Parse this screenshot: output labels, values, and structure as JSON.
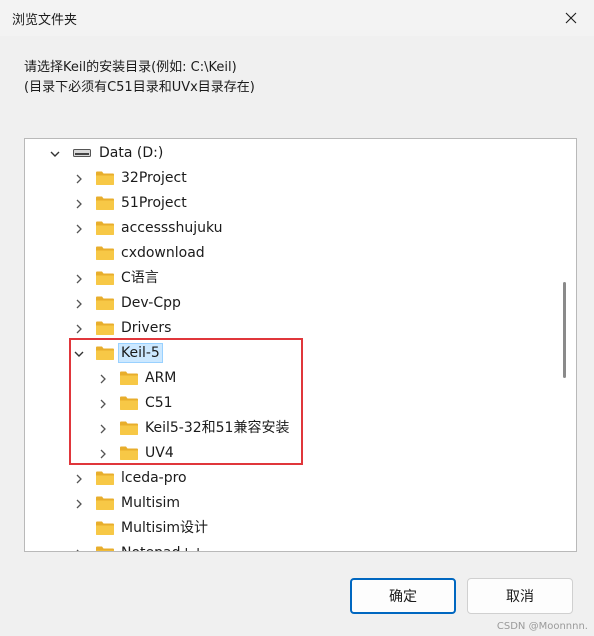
{
  "window": {
    "title": "浏览文件夹"
  },
  "instruction": {
    "line1": "请选择Keil的安装目录(例如: C:\\Keil)",
    "line2": "(目录下必须有C51目录和UVx目录存在)"
  },
  "tree": {
    "drive": {
      "label": "Data (D:)",
      "icon": "drive-icon",
      "expanded": true
    },
    "items": [
      {
        "label": "32Project",
        "level": 1,
        "expander": "collapsed"
      },
      {
        "label": "51Project",
        "level": 1,
        "expander": "collapsed"
      },
      {
        "label": "accessshujuku",
        "level": 1,
        "expander": "collapsed"
      },
      {
        "label": "cxdownload",
        "level": 1,
        "expander": "none"
      },
      {
        "label": "C语言",
        "level": 1,
        "expander": "collapsed"
      },
      {
        "label": "Dev-Cpp",
        "level": 1,
        "expander": "collapsed"
      },
      {
        "label": "Drivers",
        "level": 1,
        "expander": "collapsed"
      },
      {
        "label": "Keil-5",
        "level": 1,
        "expander": "expanded",
        "selected": true
      },
      {
        "label": "ARM",
        "level": 2,
        "expander": "collapsed"
      },
      {
        "label": "C51",
        "level": 2,
        "expander": "collapsed"
      },
      {
        "label": "Keil5-32和51兼容安装",
        "level": 2,
        "expander": "collapsed"
      },
      {
        "label": "UV4",
        "level": 2,
        "expander": "collapsed"
      },
      {
        "label": "lceda-pro",
        "level": 1,
        "expander": "collapsed"
      },
      {
        "label": "Multisim",
        "level": 1,
        "expander": "collapsed"
      },
      {
        "label": "Multisim设计",
        "level": 1,
        "expander": "none"
      },
      {
        "label": "Notepad++",
        "level": 1,
        "expander": "collapsed"
      }
    ]
  },
  "buttons": {
    "ok": "确定",
    "cancel": "取消"
  },
  "watermark": "CSDN @Moonnnn.",
  "colors": {
    "folder": "#f7c846",
    "folder_back": "#e8ae2c",
    "selection": "#cce8ff",
    "highlight_box": "#e0363b",
    "primary_border": "#0067c0"
  }
}
